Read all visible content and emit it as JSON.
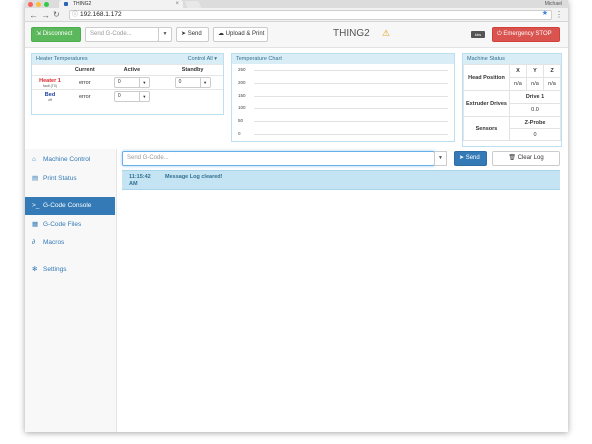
{
  "browser": {
    "tab_title": "THING2",
    "user": "Michael",
    "url": "192.168.1.172"
  },
  "topbar": {
    "disconnect": "Disconnect",
    "gcode_placeholder": "Send G-Code...",
    "send": "Send",
    "upload_print": "Upload & Print",
    "machine_name": "THING2",
    "kbd_badge": "kbs",
    "emergency": "Emergency STOP"
  },
  "heater_panel": {
    "title": "Heater Temperatures",
    "control_all": "Control All",
    "columns": [
      "",
      "Current",
      "Active",
      "Standby"
    ],
    "rows": [
      {
        "name": "Heater 1",
        "sub": "fault (T0)",
        "current": "error",
        "active": "0",
        "standby": "0",
        "color": "#d9262b"
      },
      {
        "name": "Bed",
        "sub": "off",
        "current": "error",
        "active": "0",
        "standby": "",
        "color": "#1a3e9e"
      }
    ]
  },
  "temp_chart": {
    "title": "Temperature Chart",
    "y_ticks": [
      "250",
      "200",
      "150",
      "100",
      "50",
      "0"
    ]
  },
  "chart_data": {
    "type": "line",
    "title": "Temperature Chart",
    "ylim": [
      0,
      250
    ],
    "y_ticks": [
      250,
      200,
      150,
      100,
      50,
      0
    ],
    "series": []
  },
  "machine_status": {
    "title": "Machine Status",
    "head_position": "Head Position",
    "axes": [
      "X",
      "Y",
      "Z"
    ],
    "positions": [
      "n/a",
      "n/a",
      "n/a"
    ],
    "extruder_drives": "Extruder Drives",
    "drive_label": "Drive 1",
    "drive_value": "0.0",
    "sensors": "Sensors",
    "zprobe_label": "Z-Probe",
    "zprobe_value": "0"
  },
  "sidebar": {
    "items": [
      {
        "label": "Machine Control",
        "icon": "house-icon"
      },
      {
        "label": "Print Status",
        "icon": "printer-icon"
      },
      {
        "label": "G-Code Console",
        "icon": "terminal-icon"
      },
      {
        "label": "G-Code Files",
        "icon": "files-icon"
      },
      {
        "label": "Macros",
        "icon": "link-icon"
      },
      {
        "label": "Settings",
        "icon": "gear-icon"
      }
    ]
  },
  "console": {
    "placeholder": "Send G-Code...",
    "send": "Send",
    "clear_log": "Clear Log",
    "log": [
      {
        "time": "11:15:42 AM",
        "message": "Message Log cleared!"
      }
    ]
  },
  "colors": {
    "green": "#5cb85c",
    "red": "#d9534f",
    "blue": "#337ab7",
    "panel_head": "#d9edf7"
  }
}
